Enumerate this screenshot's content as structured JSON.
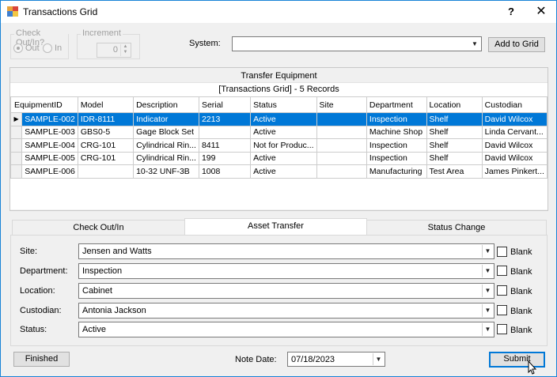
{
  "window": {
    "title": "Transactions Grid",
    "help": "?",
    "close": "✕"
  },
  "checkout": {
    "label": "Check Out/In?",
    "out_label": "Out",
    "in_label": "In",
    "selected": "Out"
  },
  "increment": {
    "label": "Increment",
    "value": "0"
  },
  "system": {
    "label": "System:",
    "value": "",
    "add_button": "Add to Grid"
  },
  "transfer_panel": {
    "caption": "Transfer Equipment"
  },
  "grid": {
    "caption": "[Transactions Grid] - 5 Records",
    "columns": [
      "EquipmentID",
      "Model",
      "Description",
      "Serial",
      "Status",
      "Site",
      "Department",
      "Location",
      "Custodian"
    ],
    "rows": [
      [
        "SAMPLE-002",
        "IDR-8111",
        "Indicator",
        "2213",
        "Active",
        "",
        "Inspection",
        "Shelf",
        "David Wilcox"
      ],
      [
        "SAMPLE-003",
        "GBS0-5",
        "Gage Block Set",
        "",
        "Active",
        "",
        "Machine Shop",
        "Shelf",
        "Linda Cervant..."
      ],
      [
        "SAMPLE-004",
        "CRG-101",
        "Cylindrical Rin...",
        "8411",
        "Not for Produc...",
        "",
        "Inspection",
        "Shelf",
        "David Wilcox"
      ],
      [
        "SAMPLE-005",
        "CRG-101",
        "Cylindrical Rin...",
        "199",
        "Active",
        "",
        "Inspection",
        "Shelf",
        "David Wilcox"
      ],
      [
        "SAMPLE-006",
        "",
        "10-32 UNF-3B",
        "1008",
        "Active",
        "",
        "Manufacturing",
        "Test Area",
        "James Pinkert..."
      ]
    ],
    "selected_row": 0,
    "current_row_marker": "▶"
  },
  "tabs": [
    "Check Out/In",
    "Asset Transfer",
    "Status Change"
  ],
  "active_tab": "Asset Transfer",
  "fields": {
    "site": {
      "label": "Site:",
      "value": "Jensen and Watts",
      "blank": "Blank"
    },
    "department": {
      "label": "Department:",
      "value": "Inspection",
      "blank": "Blank"
    },
    "location": {
      "label": "Location:",
      "value": "Cabinet",
      "blank": "Blank"
    },
    "custodian": {
      "label": "Custodian:",
      "value": "Antonia Jackson",
      "blank": "Blank"
    },
    "status": {
      "label": "Status:",
      "value": "Active",
      "blank": "Blank"
    }
  },
  "footer": {
    "finished": "Finished",
    "note_date_label": "Note Date:",
    "note_date_value": "07/18/2023",
    "submit": "Submit"
  },
  "colors": {
    "selection": "#0078d7",
    "window_border": "#1883d7",
    "background": "#f0f0f0"
  }
}
